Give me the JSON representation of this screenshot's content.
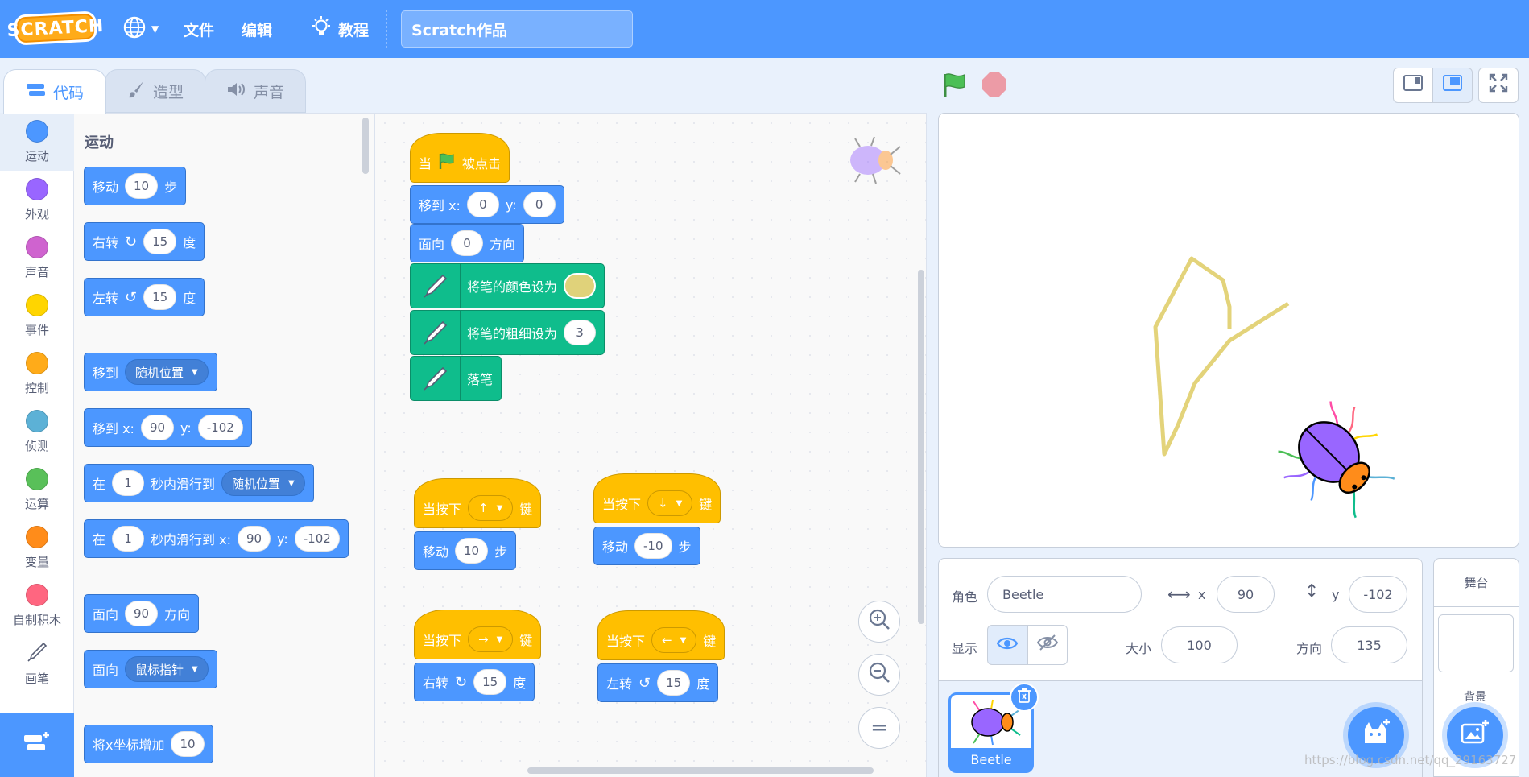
{
  "menu": {
    "logo": "SCRATCH",
    "file": "文件",
    "edit": "编辑",
    "tutorials": "教程",
    "project_title": "Scratch作品"
  },
  "tabs": {
    "code": "代码",
    "costumes": "造型",
    "sounds": "声音"
  },
  "categories": [
    {
      "label": "运动",
      "color": "#4c97ff"
    },
    {
      "label": "外观",
      "color": "#9966ff"
    },
    {
      "label": "声音",
      "color": "#cf63cf"
    },
    {
      "label": "事件",
      "color": "#ffd500"
    },
    {
      "label": "控制",
      "color": "#ffab19"
    },
    {
      "label": "侦测",
      "color": "#5cb1d6"
    },
    {
      "label": "运算",
      "color": "#59c059"
    },
    {
      "label": "变量",
      "color": "#ff8c1a"
    },
    {
      "label": "自制积木",
      "color": "#ff6680"
    },
    {
      "label": "画笔",
      "color": "#0fbd8c"
    }
  ],
  "palette": {
    "heading": "运动",
    "move": {
      "a": "移动",
      "v": "10",
      "b": "步"
    },
    "turn_right": {
      "a": "右转",
      "v": "15",
      "b": "度"
    },
    "turn_left": {
      "a": "左转",
      "v": "15",
      "b": "度"
    },
    "goto": {
      "a": "移到",
      "d": "随机位置"
    },
    "goto_xy": {
      "a": "移到 x:",
      "x": "90",
      "y_lbl": "y:",
      "y": "-102"
    },
    "glide": {
      "a": "在",
      "v": "1",
      "b": "秒内滑行到",
      "d": "随机位置"
    },
    "glide_xy": {
      "a": "在",
      "v": "1",
      "b": "秒内滑行到 x:",
      "x": "90",
      "y_lbl": "y:",
      "y": "-102"
    },
    "point": {
      "a": "面向",
      "v": "90",
      "b": "方向"
    },
    "point_to": {
      "a": "面向",
      "d": "鼠标指针"
    },
    "change_x": {
      "a": "将x坐标增加",
      "v": "10"
    }
  },
  "script_main": {
    "hat": {
      "a": "当",
      "b": "被点击"
    },
    "goto": {
      "a": "移到 x:",
      "x": "0",
      "y_lbl": "y:",
      "y": "0"
    },
    "point": {
      "a": "面向",
      "v": "0",
      "b": "方向"
    },
    "pen_color": "将笔的颜色设为",
    "pen_size": {
      "a": "将笔的粗细设为",
      "v": "3"
    },
    "pen_down": "落笔"
  },
  "script_up": {
    "a": "当按下",
    "key": "↑",
    "b": "键",
    "move_a": "移动",
    "move_v": "10",
    "move_b": "步"
  },
  "script_down": {
    "a": "当按下",
    "key": "↓",
    "b": "键",
    "move_a": "移动",
    "move_v": "-10",
    "move_b": "步"
  },
  "script_right": {
    "a": "当按下",
    "key": "→",
    "b": "键",
    "turn_a": "右转",
    "turn_v": "15",
    "turn_b": "度"
  },
  "script_left": {
    "a": "当按下",
    "key": "←",
    "b": "键",
    "turn_a": "左转",
    "turn_v": "15",
    "turn_b": "度"
  },
  "sprite_info": {
    "sprite_label": "角色",
    "sprite_name": "Beetle",
    "x_label": "x",
    "x": "90",
    "y_label": "y",
    "y": "-102",
    "show_label": "显示",
    "size_label": "大小",
    "size": "100",
    "direction_label": "方向",
    "direction": "135"
  },
  "sprites": [
    {
      "name": "Beetle"
    }
  ],
  "stage_pane": {
    "title": "舞台",
    "backdrops": "背景"
  },
  "watermark": "https://blog.csdn.net/qq_29163727",
  "colors": {
    "menu": "#4c97ff",
    "motion": "#4c97ff",
    "events": "#ffbf00",
    "pen": "#0fbd8c",
    "pen_trail": "#e3d37a"
  }
}
